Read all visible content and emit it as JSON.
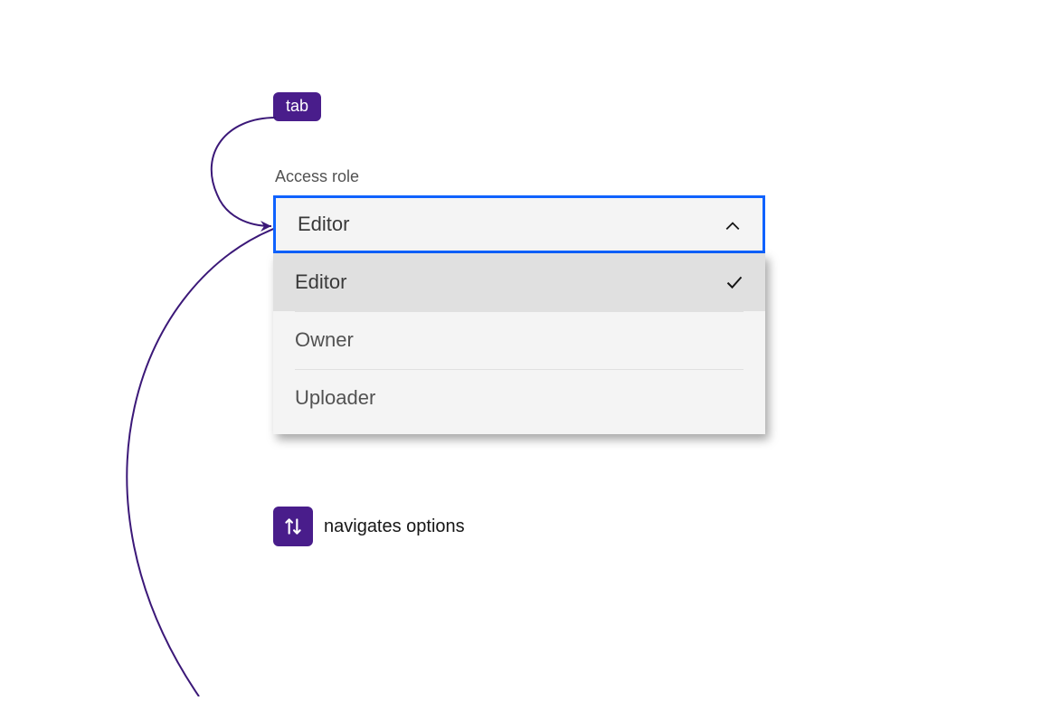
{
  "annotation": {
    "tab_key_label": "tab",
    "hint_text": "navigates options"
  },
  "combobox": {
    "label": "Access role",
    "selected": "Editor",
    "expanded": true,
    "options": [
      {
        "label": "Editor",
        "selected": true
      },
      {
        "label": "Owner",
        "selected": false
      },
      {
        "label": "Uploader",
        "selected": false
      }
    ]
  },
  "colors": {
    "accent_purple": "#491d8b",
    "focus_blue": "#0f62fe",
    "surface": "#f4f4f4",
    "selected_row": "#e0e0e0"
  }
}
